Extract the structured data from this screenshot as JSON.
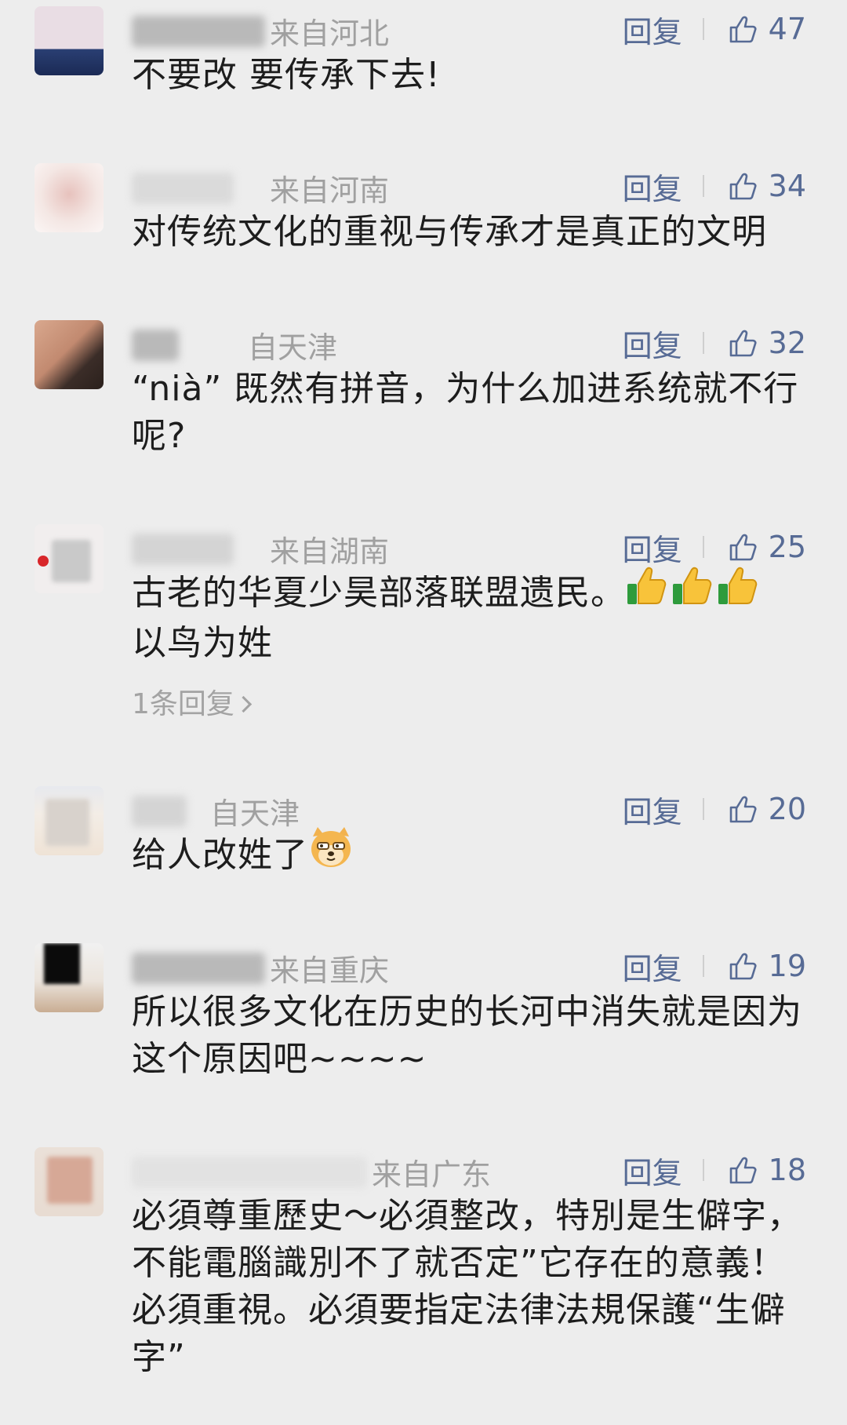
{
  "comments": [
    {
      "location": "来自河北",
      "reply_label": "回复",
      "likes": "47",
      "text": "不要改 要传承下去!",
      "avatar_colors": [
        "#2a3f73",
        "#e9dde4"
      ]
    },
    {
      "location": "来自河南",
      "reply_label": "回复",
      "likes": "34",
      "text": "对传统文化的重视与传承才是真正的文明",
      "avatar_colors": [
        "#f3e3e0",
        "#d8a8a2"
      ]
    },
    {
      "location": "自天津",
      "reply_label": "回复",
      "likes": "32",
      "text": "“nià” 既然有拼音，为什么加进系统就不行呢?",
      "avatar_colors": [
        "#3d2f2a",
        "#d7a58c"
      ]
    },
    {
      "location": "来自湖南",
      "reply_label": "回复",
      "likes": "25",
      "text": "古老的华夏少昊部落联盟遗民。",
      "text2": "以鸟为姓",
      "emoji": "thumbs-up-icon",
      "sub_replies": "1条回复",
      "avatar_colors": [
        "#f0f0f0",
        "#c9c9c9"
      ]
    },
    {
      "location": "自天津",
      "reply_label": "回复",
      "likes": "20",
      "text": "给人改姓了",
      "emoji": "doge-icon",
      "avatar_colors": [
        "#f2ece6",
        "#dcd6cf"
      ]
    },
    {
      "location": "来自重庆",
      "reply_label": "回复",
      "likes": "19",
      "text": "所以很多文化在历史的长河中消失就是因为这个原因吧~~~~",
      "avatar_colors": [
        "#121212",
        "#c8b09a"
      ]
    },
    {
      "location": "来自广东",
      "reply_label": "回复",
      "likes": "18",
      "text": "必須尊重歷史～必須整改，特別是生僻字，不能電腦識別不了就否定”它存在的意義！必須重視。必須要指定法律法規保護“生僻字”",
      "avatar_colors": [
        "#eadfd7",
        "#d7a897"
      ]
    }
  ]
}
